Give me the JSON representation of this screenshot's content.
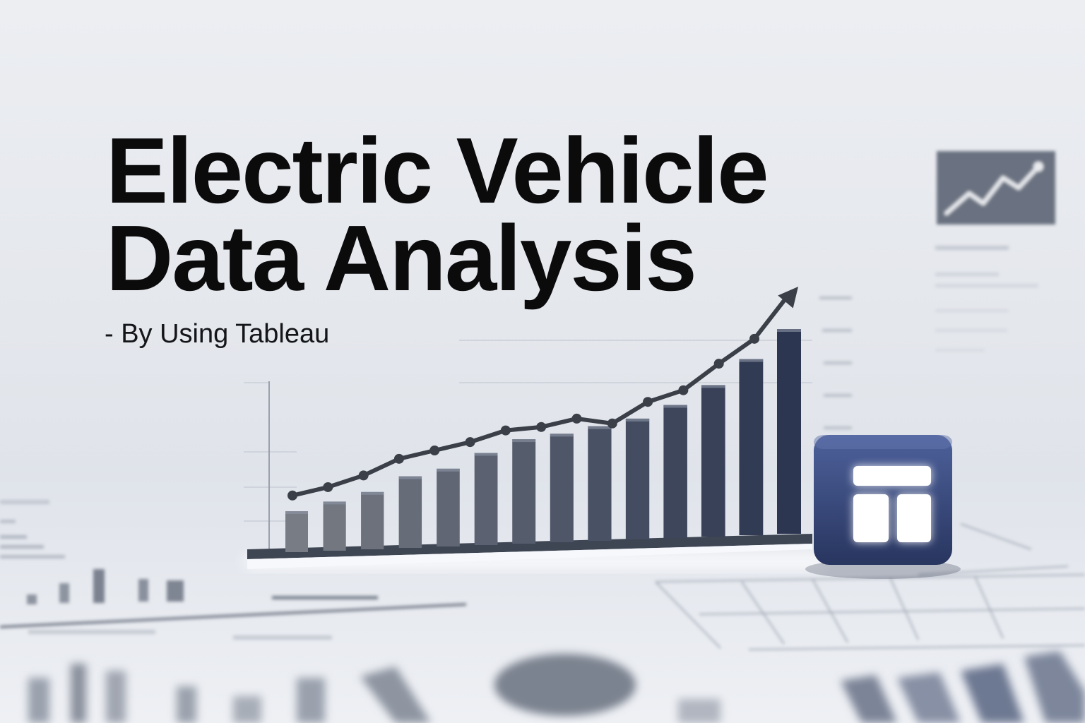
{
  "slide": {
    "title_line_1": "Electric Vehicle",
    "title_line_2": "Data Analysis",
    "subtitle": "- By Using Tableau"
  },
  "colors": {
    "background": "#e6e9ee",
    "title_text": "#0b0b0c",
    "bar_dark": "#2f3d55",
    "bar_light": "#6a6f78",
    "trend_line": "#3a3f48",
    "tableau_cube": "#3c4f86",
    "tableau_glow": "#ffffff"
  },
  "icons": {
    "trend_arrow": "trend-arrow-icon",
    "tableau_logo": "tableau-logo-icon",
    "mini_chart": "line-chart-card-icon"
  },
  "chart_data": {
    "type": "bar",
    "bar_values": [
      20,
      24,
      28,
      35,
      38,
      45,
      51,
      53,
      56,
      59,
      65,
      74,
      86,
      100
    ],
    "line_values": [
      30,
      35,
      42,
      52,
      57,
      62,
      69,
      71,
      76,
      73,
      86,
      93,
      109,
      124
    ]
  }
}
